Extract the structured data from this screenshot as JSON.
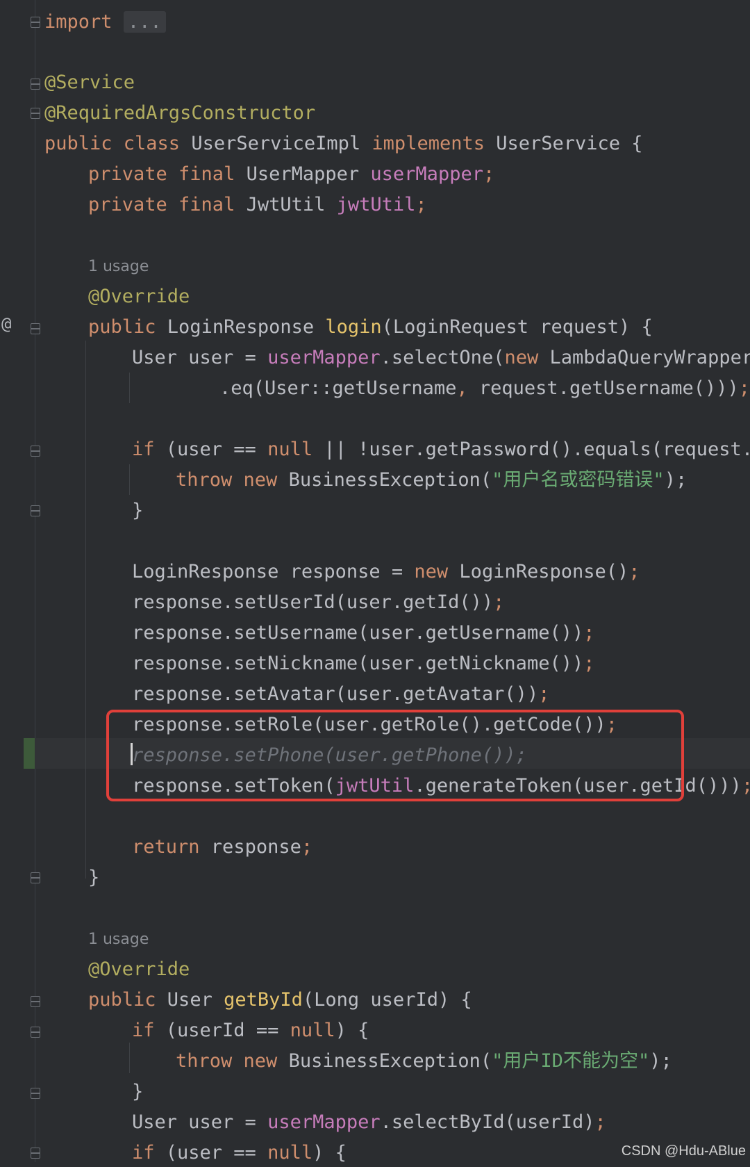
{
  "editor": {
    "usage_hint_1": "1 usage",
    "usage_hint_2": "1 usage",
    "gutter_icon_label": "@",
    "watermark": "CSDN @Hdu-ABlue",
    "highlight_color": "#e0403a"
  },
  "code": {
    "l1_kw": "import",
    "l1_fold": "...",
    "l2": "@Service",
    "l3": "@RequiredArgsConstructor",
    "l4_a": "public class",
    "l4_b": " UserServiceImpl ",
    "l4_c": "implements",
    "l4_d": " UserService {",
    "l5_a": "private final",
    "l5_b": " UserMapper ",
    "l5_c": "userMapper",
    "l5_d": ";",
    "l6_a": "private final",
    "l6_b": " JwtUtil ",
    "l6_c": "jwtUtil",
    "l6_d": ";",
    "l7": "@Override",
    "l8_a": "public",
    "l8_b": " LoginResponse ",
    "l8_c": "login",
    "l8_d": "(LoginRequest request) {",
    "l9_a": "User user = ",
    "l9_b": "userMapper",
    "l9_c": ".selectOne(",
    "l9_d": "new",
    "l9_e": " LambdaQueryWrapper<U",
    "l10_a": ".eq(User::getUsername",
    "l10_b": ",",
    "l10_c": " request.getUsername()))",
    "l10_d": ";",
    "l11_a": "if",
    "l11_b": " (user == ",
    "l11_c": "null",
    "l11_d": " || !user.getPassword().equals(request.get",
    "l12_a": "throw new",
    "l12_b": " BusinessException(",
    "l12_c": "\"用户名或密码错误\"",
    "l12_d": ");",
    "l13": "}",
    "l14_a": "LoginResponse response = ",
    "l14_b": "new",
    "l14_c": " LoginResponse()",
    "l14_d": ";",
    "l15_a": "response.setUserId(user.getId())",
    "l15_b": ";",
    "l16_a": "response.setUsername(user.getUsername())",
    "l16_b": ";",
    "l17_a": "response.setNickname(user.getNickname())",
    "l17_b": ";",
    "l18_a": "response.setAvatar(user.getAvatar())",
    "l18_b": ";",
    "l19_a": "response.setRole(user.getRole().getCode())",
    "l19_b": ";",
    "l20": "response.setPhone(user.getPhone());",
    "l21_a": "response.setToken(",
    "l21_b": "jwtUtil",
    "l21_c": ".generateToken(user.getId()))",
    "l21_d": ";",
    "l22_a": "return",
    "l22_b": " response",
    "l22_c": ";",
    "l23": "}",
    "l24": "@Override",
    "l25_a": "public",
    "l25_b": " User ",
    "l25_c": "getById",
    "l25_d": "(Long userId) {",
    "l26_a": "if",
    "l26_b": " (userId == ",
    "l26_c": "null",
    "l26_d": ") {",
    "l27_a": "throw new",
    "l27_b": " BusinessException(",
    "l27_c": "\"用户ID不能为空\"",
    "l27_d": ");",
    "l28": "}",
    "l29_a": "User user = ",
    "l29_b": "userMapper",
    "l29_c": ".selectById(userId)",
    "l29_d": ";",
    "l30_a": "if",
    "l30_b": " (user == ",
    "l30_c": "null",
    "l30_d": ") {"
  }
}
